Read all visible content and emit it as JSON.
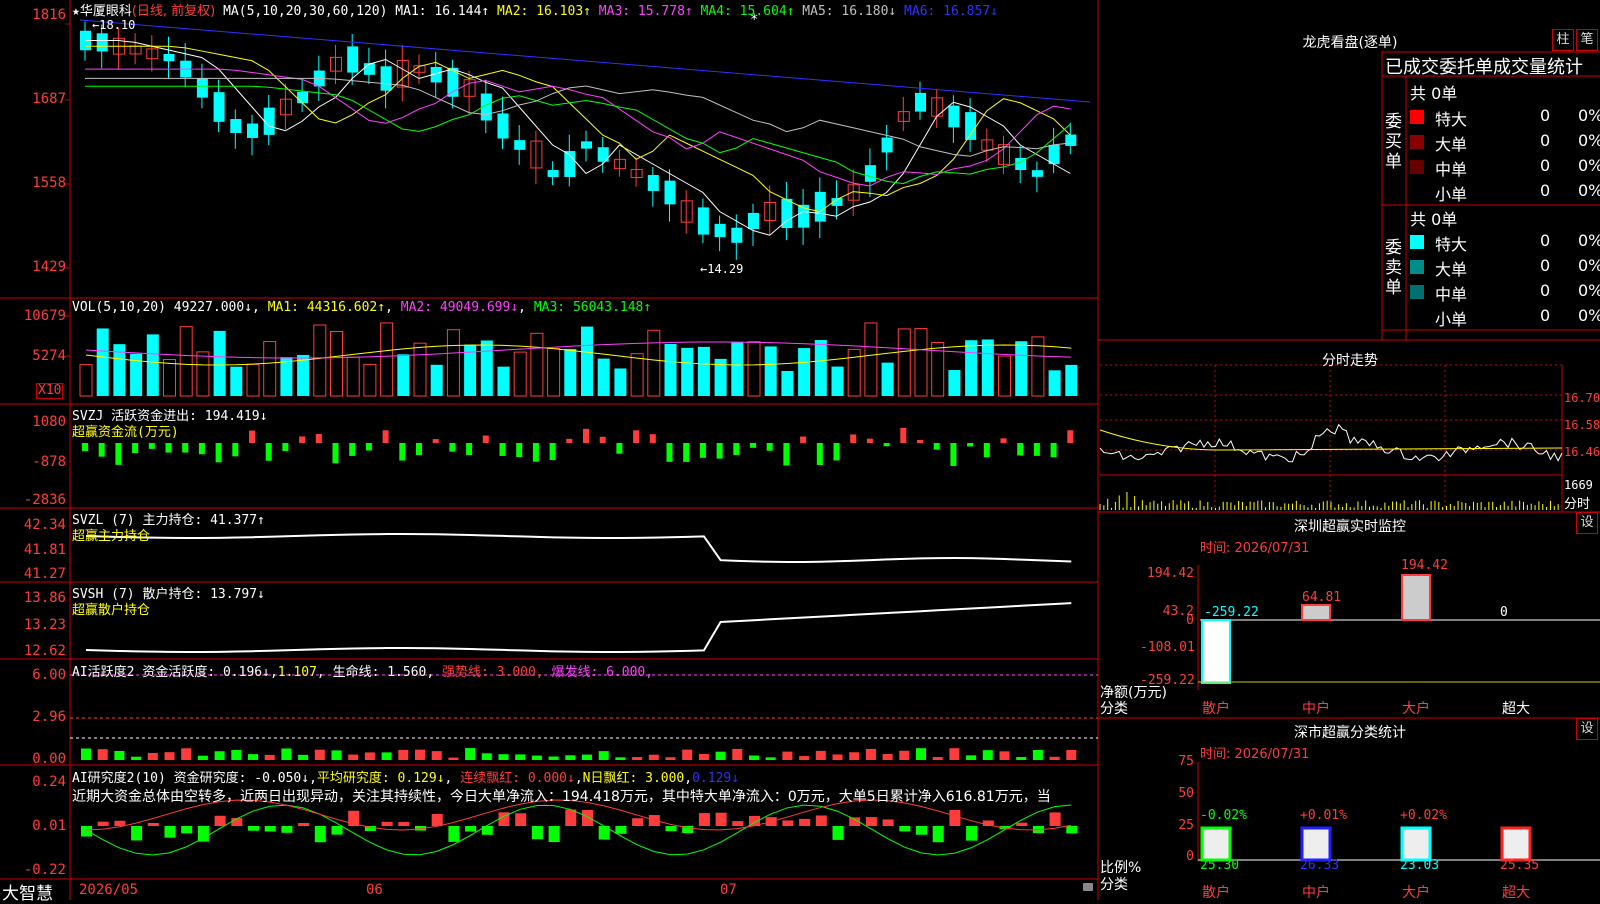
{
  "colors": {
    "up": "#ff3c3c",
    "down": "#00ffff",
    "grid": "#cc0000",
    "ma1": "#ffffff",
    "ma2": "#ffff00",
    "ma3": "#ff40ff",
    "ma4": "#00ff00",
    "ma5": "#c0c0c0",
    "ma6": "#3030ff"
  },
  "kline": {
    "star": "★",
    "name": "华厦眼科",
    "period": "(日线, 前复权)",
    "ma_params": "MA(5,10,20,30,60,120)",
    "ma1": "MA1: 16.144↑",
    "ma2": "MA2: 16.103↑",
    "ma3": "MA3: 15.778↑",
    "ma4": "MA4: 15.604↑",
    "ma5": "MA5: 16.180↓",
    "ma6": "MA6: 16.857↓",
    "y_labels": [
      "1816",
      "1687",
      "1558",
      "1429"
    ],
    "high_label": "←18.10",
    "low_label": "←14.29",
    "asterisk": "*"
  },
  "vol": {
    "header": "VOL(5,10,20)",
    "value": "49227.000↓",
    "ma1": "MA1: 44316.602↑",
    "ma2": "MA2: 49049.699↓",
    "ma3": "MA3: 56043.148↑",
    "y_labels": [
      "10679",
      "5274"
    ],
    "unit": "X10"
  },
  "svzj": {
    "header": "SVZJ  活跃资金进出: 194.419↓",
    "sub": "超赢资金流(万元)",
    "y_labels": [
      "1080",
      "-878",
      "-2836"
    ]
  },
  "svzl": {
    "header": "SVZL (7) 主力持仓: 41.377↑",
    "sub": "超赢主力持仓",
    "y_labels": [
      "42.34",
      "41.81",
      "41.27"
    ]
  },
  "svsh": {
    "header": "SVSH (7) 散户持仓: 13.797↓",
    "sub": "超赢散户持仓",
    "y_labels": [
      "13.86",
      "13.23",
      "12.62"
    ]
  },
  "ai_active": {
    "title": "AI活跃度2",
    "fund": "资金活跃度: 0.196↓",
    "val2": "1.107",
    "life": "生命线: 1.560",
    "strong": "强势线: 3.000",
    "burst": "爆发线: 6.000",
    "y_labels": [
      "6.00",
      "2.96",
      "0.00"
    ]
  },
  "ai_research": {
    "title": "AI研究度2(10)",
    "fund": "资金研究度: -0.050↓",
    "avg": "平均研究度: 0.129↓",
    "cont": "连续飘红: 0.000↓",
    "nday": "N日飘红: 3.000",
    "last": "0.129↓",
    "commentary": "近期大资金总体由空转多，近两日出现异动，关注其持续性，今日大单净流入：194.418万元，其中特大单净流入：0万元，大单5日累计净入616.81万元，当",
    "y_labels": [
      "0.24",
      "0.01",
      "-0.22"
    ]
  },
  "bottom": {
    "logo": "大智慧",
    "dates": [
      "2026/05",
      "06",
      "07"
    ]
  },
  "right": {
    "dragon_title": "龙虎看盘(逐单)",
    "btn_col": "柱",
    "btn_note": "笔",
    "tabs_line": "已成交委托单成交量统计",
    "buy_side": "委买单",
    "sell_side": "委卖单",
    "buy_total": "共 0单",
    "sell_total": "共 0单",
    "buy_rows": [
      {
        "label": "特大",
        "count": "0",
        "pct": "0%",
        "color": "#ff0000"
      },
      {
        "label": "大单",
        "count": "0",
        "pct": "0%",
        "color": "#8b0000"
      },
      {
        "label": "中单",
        "count": "0",
        "pct": "0%",
        "color": "#660000"
      },
      {
        "label": "小单",
        "count": "0",
        "pct": "0%",
        "color": ""
      }
    ],
    "sell_rows": [
      {
        "label": "特大",
        "count": "0",
        "pct": "0%",
        "color": "#00ffff"
      },
      {
        "label": "大单",
        "count": "0",
        "pct": "0%",
        "color": "#008b8b"
      },
      {
        "label": "中单",
        "count": "0",
        "pct": "0%",
        "color": "#007070"
      },
      {
        "label": "小单",
        "count": "0",
        "pct": "0%",
        "color": ""
      }
    ],
    "intraday_title": "分时走势",
    "intraday_y": [
      "16.70",
      "16.58",
      "16.46"
    ],
    "intraday_vol": "1669",
    "intraday_unit": "分时",
    "monitor_title": "深圳超赢实时监控",
    "monitor_set": "设",
    "monitor_time": "时间: 2026/07/31",
    "monitor_y": [
      "194.42",
      "43.2",
      "0",
      "-108.01",
      "-259.22"
    ],
    "monitor_bars": [
      {
        "label": "散户",
        "value": -259.22,
        "text": "-259.22"
      },
      {
        "label": "中户",
        "value": 64.81,
        "text": "64.81"
      },
      {
        "label": "大户",
        "value": 194.42,
        "text": "194.42"
      },
      {
        "label": "超大",
        "value": 0,
        "text": "0"
      }
    ],
    "monitor_axis": "净额(万元)",
    "monitor_cat": "分类",
    "class_title": "深市超赢分类统计",
    "class_set": "设",
    "class_time": "时间: 2026/07/31",
    "class_y": [
      "75",
      "50",
      "25",
      "0"
    ],
    "class_bars": [
      {
        "label": "散户",
        "value": 25.3,
        "change": "-0.02%",
        "text": "25.30",
        "bar_color": "#00ff00",
        "chg_color": "#00ff00",
        "val_color": "#00ff00"
      },
      {
        "label": "中户",
        "value": 26.33,
        "change": "+0.01%",
        "text": "26.33",
        "bar_color": "#2020ff",
        "chg_color": "#ff3c3c",
        "val_color": "#2020ff"
      },
      {
        "label": "大户",
        "value": 23.03,
        "change": "+0.02%",
        "text": "23.03",
        "bar_color": "#00ffff",
        "chg_color": "#ff3c3c",
        "val_color": "#00ffff"
      },
      {
        "label": "超大",
        "value": 25.35,
        "change": "",
        "text": "25.35",
        "bar_color": "#ff2020",
        "chg_color": "#ff3c3c",
        "val_color": "#ff3c3c"
      }
    ],
    "class_axis": "比例%",
    "class_cat": "分类"
  }
}
